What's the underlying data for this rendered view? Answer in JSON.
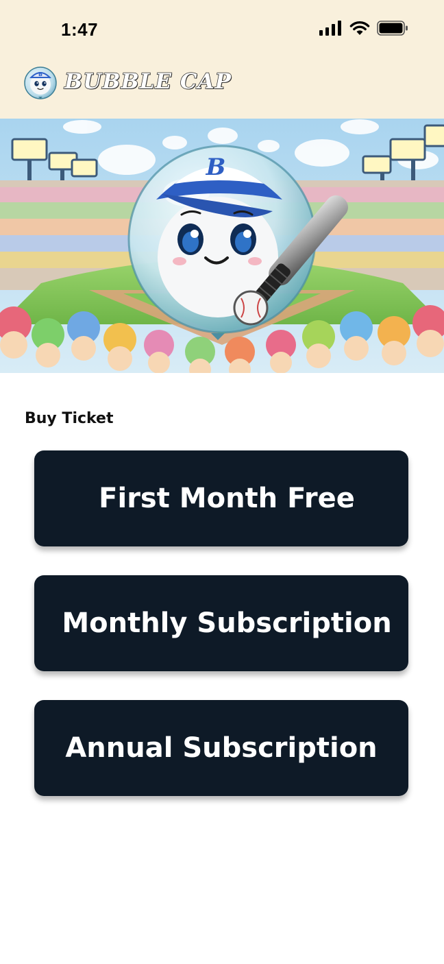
{
  "status_bar": {
    "time": "1:47",
    "icons": [
      "cellular-signal-icon",
      "wifi-icon",
      "battery-icon"
    ]
  },
  "header": {
    "logo_icon": "bubble-cap-mascot-icon",
    "app_name": "BUBBLE CAP"
  },
  "hero": {
    "image": "bubble mascot wearing baseball cap holding bat in stadium"
  },
  "purchase": {
    "section_title": "Buy Ticket",
    "options": [
      {
        "label": "First Month Free"
      },
      {
        "label": "Monthly Subscription"
      },
      {
        "label": "Annual Subscription"
      }
    ]
  },
  "colors": {
    "header_background": "#f9f0dc",
    "button_background": "#0e1a27",
    "button_text": "#ffffff"
  }
}
